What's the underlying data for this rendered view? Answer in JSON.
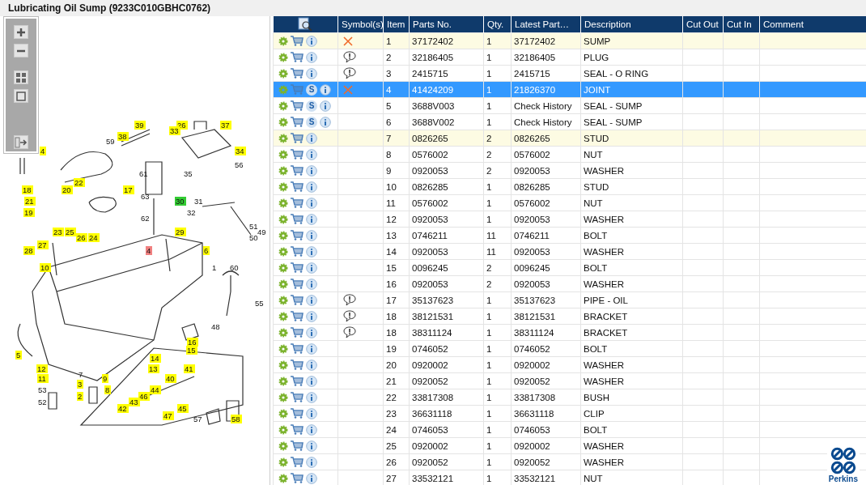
{
  "title": "Lubricating Oil Sump (9233C010GBHC0762)",
  "callouts": [
    {
      "label": "39",
      "color": "#ffff00"
    },
    {
      "label": "26",
      "color": "#ffff00"
    },
    {
      "label": "37",
      "color": "#ffff00"
    },
    {
      "label": "33",
      "color": "#ffff00"
    },
    {
      "label": "38",
      "color": "#ffff00"
    },
    {
      "label": "59"
    },
    {
      "label": "4",
      "color": "#ffff00"
    },
    {
      "label": "34",
      "color": "#ffff00"
    },
    {
      "label": "56"
    },
    {
      "label": "61"
    },
    {
      "label": "35"
    },
    {
      "label": "22",
      "color": "#ffff00"
    },
    {
      "label": "18",
      "color": "#ffff00"
    },
    {
      "label": "20",
      "color": "#ffff00"
    },
    {
      "label": "17",
      "color": "#ffff00"
    },
    {
      "label": "63"
    },
    {
      "label": "21",
      "color": "#ffff00"
    },
    {
      "label": "30",
      "color": "#33cc33"
    },
    {
      "label": "31"
    },
    {
      "label": "19",
      "color": "#ffff00"
    },
    {
      "label": "32"
    },
    {
      "label": "62"
    },
    {
      "label": "51"
    },
    {
      "label": "23",
      "color": "#ffff00"
    },
    {
      "label": "25",
      "color": "#ffff00"
    },
    {
      "label": "29",
      "color": "#ffff00"
    },
    {
      "label": "49"
    },
    {
      "label": "26",
      "color": "#ffff00"
    },
    {
      "label": "24",
      "color": "#ffff00"
    },
    {
      "label": "50"
    },
    {
      "label": "27",
      "color": "#ffff00"
    },
    {
      "label": "28",
      "color": "#ffff00"
    },
    {
      "label": "4",
      "color": "#f08080"
    },
    {
      "label": "6",
      "color": "#ffff00"
    },
    {
      "label": "10",
      "color": "#ffff00"
    },
    {
      "label": "1"
    },
    {
      "label": "60"
    },
    {
      "label": "55"
    },
    {
      "label": "48"
    },
    {
      "label": "16",
      "color": "#ffff00"
    },
    {
      "label": "15",
      "color": "#ffff00"
    },
    {
      "label": "5",
      "color": "#ffff00"
    },
    {
      "label": "14",
      "color": "#ffff00"
    },
    {
      "label": "12",
      "color": "#ffff00"
    },
    {
      "label": "13",
      "color": "#ffff00"
    },
    {
      "label": "41",
      "color": "#ffff00"
    },
    {
      "label": "7"
    },
    {
      "label": "11",
      "color": "#ffff00"
    },
    {
      "label": "9",
      "color": "#ffff00"
    },
    {
      "label": "40",
      "color": "#ffff00"
    },
    {
      "label": "3",
      "color": "#ffff00"
    },
    {
      "label": "53"
    },
    {
      "label": "8",
      "color": "#ffff00"
    },
    {
      "label": "44",
      "color": "#ffff00"
    },
    {
      "label": "2",
      "color": "#ffff00"
    },
    {
      "label": "46",
      "color": "#ffff00"
    },
    {
      "label": "52"
    },
    {
      "label": "43",
      "color": "#ffff00"
    },
    {
      "label": "42",
      "color": "#ffff00"
    },
    {
      "label": "45",
      "color": "#ffff00"
    },
    {
      "label": "47",
      "color": "#ffff00"
    },
    {
      "label": "57"
    },
    {
      "label": "58",
      "color": "#ffff00"
    }
  ],
  "table": {
    "columns": [
      "",
      "Symbol(s)",
      "Item",
      "Parts No.",
      "Qty.",
      "Latest Part…",
      "Description",
      "Cut Out",
      "Cut In",
      "Comment"
    ],
    "rows": [
      {
        "kind": "cross",
        "highlighted": true,
        "selected": false,
        "cells": [
          "",
          "",
          "1",
          "37172402",
          "1",
          "37172402",
          "SUMP"
        ]
      },
      {
        "kind": "note",
        "highlighted": false,
        "selected": false,
        "cells": [
          "",
          "",
          "2",
          "32186405",
          "1",
          "32186405",
          "PLUG"
        ]
      },
      {
        "kind": "note",
        "highlighted": false,
        "selected": false,
        "cells": [
          "",
          "",
          "3",
          "2415715",
          "1",
          "2415715",
          "SEAL - O RING"
        ]
      },
      {
        "kind": "cross",
        "badge": "S",
        "highlighted": false,
        "selected": true,
        "cells": [
          "",
          "",
          "4",
          "41424209",
          "1",
          "21826370",
          "JOINT"
        ]
      },
      {
        "badge": "S",
        "highlighted": false,
        "selected": false,
        "cells": [
          "",
          "",
          "5",
          "3688V003",
          "1",
          "Check History",
          "SEAL - SUMP"
        ]
      },
      {
        "badge": "S",
        "highlighted": false,
        "selected": false,
        "cells": [
          "",
          "",
          "6",
          "3688V002",
          "1",
          "Check History",
          "SEAL - SUMP"
        ]
      },
      {
        "highlighted": true,
        "selected": false,
        "cells": [
          "",
          "",
          "7",
          "0826265",
          "2",
          "0826265",
          "STUD"
        ]
      },
      {
        "highlighted": false,
        "selected": false,
        "cells": [
          "",
          "",
          "8",
          "0576002",
          "2",
          "0576002",
          "NUT"
        ]
      },
      {
        "highlighted": false,
        "selected": false,
        "cells": [
          "",
          "",
          "9",
          "0920053",
          "2",
          "0920053",
          "WASHER"
        ]
      },
      {
        "highlighted": false,
        "selected": false,
        "cells": [
          "",
          "",
          "10",
          "0826285",
          "1",
          "0826285",
          "STUD"
        ]
      },
      {
        "highlighted": false,
        "selected": false,
        "cells": [
          "",
          "",
          "11",
          "0576002",
          "1",
          "0576002",
          "NUT"
        ]
      },
      {
        "highlighted": false,
        "selected": false,
        "cells": [
          "",
          "",
          "12",
          "0920053",
          "1",
          "0920053",
          "WASHER"
        ]
      },
      {
        "highlighted": false,
        "selected": false,
        "cells": [
          "",
          "",
          "13",
          "0746211",
          "11",
          "0746211",
          "BOLT"
        ]
      },
      {
        "highlighted": false,
        "selected": false,
        "cells": [
          "",
          "",
          "14",
          "0920053",
          "11",
          "0920053",
          "WASHER"
        ]
      },
      {
        "highlighted": false,
        "selected": false,
        "cells": [
          "",
          "",
          "15",
          "0096245",
          "2",
          "0096245",
          "BOLT"
        ]
      },
      {
        "highlighted": false,
        "selected": false,
        "cells": [
          "",
          "",
          "16",
          "0920053",
          "2",
          "0920053",
          "WASHER"
        ]
      },
      {
        "kind": "note",
        "highlighted": false,
        "selected": false,
        "cells": [
          "",
          "",
          "17",
          "35137623",
          "1",
          "35137623",
          "PIPE - OIL"
        ]
      },
      {
        "kind": "note",
        "highlighted": false,
        "selected": false,
        "cells": [
          "",
          "",
          "18",
          "38121531",
          "1",
          "38121531",
          "BRACKET"
        ]
      },
      {
        "kind": "note",
        "highlighted": false,
        "selected": false,
        "cells": [
          "",
          "",
          "18",
          "38311124",
          "1",
          "38311124",
          "BRACKET"
        ]
      },
      {
        "highlighted": false,
        "selected": false,
        "cells": [
          "",
          "",
          "19",
          "0746052",
          "1",
          "0746052",
          "BOLT"
        ]
      },
      {
        "highlighted": false,
        "selected": false,
        "cells": [
          "",
          "",
          "20",
          "0920002",
          "1",
          "0920002",
          "WASHER"
        ]
      },
      {
        "highlighted": false,
        "selected": false,
        "cells": [
          "",
          "",
          "21",
          "0920052",
          "1",
          "0920052",
          "WASHER"
        ]
      },
      {
        "highlighted": false,
        "selected": false,
        "cells": [
          "",
          "",
          "22",
          "33817308",
          "1",
          "33817308",
          "BUSH"
        ]
      },
      {
        "highlighted": false,
        "selected": false,
        "cells": [
          "",
          "",
          "23",
          "36631118",
          "1",
          "36631118",
          "CLIP"
        ]
      },
      {
        "highlighted": false,
        "selected": false,
        "cells": [
          "",
          "",
          "24",
          "0746053",
          "1",
          "0746053",
          "BOLT"
        ]
      },
      {
        "highlighted": false,
        "selected": false,
        "cells": [
          "",
          "",
          "25",
          "0920002",
          "1",
          "0920002",
          "WASHER"
        ]
      },
      {
        "highlighted": false,
        "selected": false,
        "cells": [
          "",
          "",
          "26",
          "0920052",
          "1",
          "0920052",
          "WASHER"
        ]
      },
      {
        "highlighted": false,
        "selected": false,
        "cells": [
          "",
          "",
          "27",
          "33532121",
          "1",
          "33532121",
          "NUT"
        ]
      }
    ]
  },
  "logo_text": "Perkins"
}
